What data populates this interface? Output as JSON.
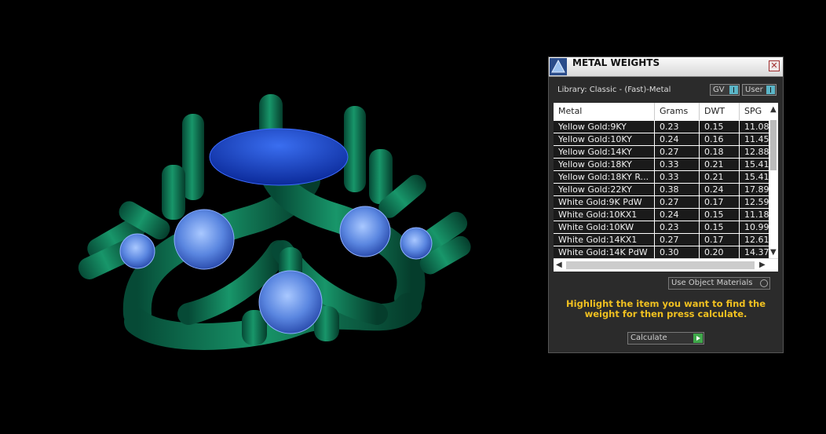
{
  "panel": {
    "title": "METAL WEIGHTS",
    "close_glyph": "✕",
    "library_label": "Library: Classic - (Fast)-Metal",
    "toggle_gv": "GV",
    "toggle_user": "User",
    "columns": [
      "Metal",
      "Grams",
      "DWT",
      "SPG"
    ],
    "rows": [
      [
        "Yellow Gold:9KY",
        "0.23",
        "0.15",
        "11.08"
      ],
      [
        "Yellow Gold:10KY",
        "0.24",
        "0.16",
        "11.45"
      ],
      [
        "Yellow Gold:14KY",
        "0.27",
        "0.18",
        "12.88"
      ],
      [
        "Yellow Gold:18KY",
        "0.33",
        "0.21",
        "15.41"
      ],
      [
        "Yellow Gold:18KY R...",
        "0.33",
        "0.21",
        "15.41"
      ],
      [
        "Yellow Gold:22KY",
        "0.38",
        "0.24",
        "17.89"
      ],
      [
        "White Gold:9K PdW",
        "0.27",
        "0.17",
        "12.59"
      ],
      [
        "White Gold:10KX1",
        "0.24",
        "0.15",
        "11.18"
      ],
      [
        "White Gold:10KW",
        "0.23",
        "0.15",
        "10.99"
      ],
      [
        "White Gold:14KX1",
        "0.27",
        "0.17",
        "12.61"
      ],
      [
        "White Gold:14K PdW",
        "0.30",
        "0.20",
        "14.37"
      ]
    ],
    "use_object_materials": "Use Object Materials",
    "instruction": "Highlight the item you want to find the weight for then press calculate.",
    "calculate_label": "Calculate"
  },
  "icons": {
    "title": "metal-weights-icon",
    "close": "close-icon",
    "scroll_up": "▲",
    "scroll_down": "▼",
    "scroll_left": "◀",
    "scroll_right": "▶"
  },
  "colors": {
    "metal": "#0f7a58",
    "stone": "#6f9ff0",
    "accent": "#f0c020",
    "toggle": "#5bb6c8",
    "go": "#3fa84a"
  }
}
